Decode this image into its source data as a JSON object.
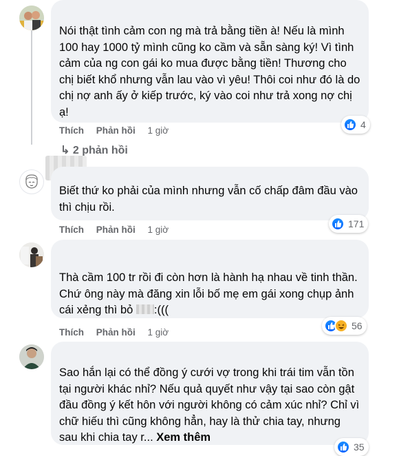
{
  "comments": [
    {
      "text": "Nói thật tình cảm con ng mà trả bằng tiền à! Nếu là mình 100 hay 1000 tỷ mình cũng ko cầm và sẵn sàng ký! Vì tình cảm của ng con gái ko mua được bằng tiền! Thương cho chị biết khổ nhưng vẫn lau vào vì yêu! Thôi coi như đó là do chị nợ anh ấy ở kiếp trước, ký vào coi như trả xong nợ chị ạ!",
      "like": "Thích",
      "reply": "Phản hồi",
      "time": "1 giờ",
      "reaction_count": "4",
      "replies": "2 phản hồi"
    },
    {
      "text": "Biết thứ ko phải của mình nhưng vẫn cố chấp đâm đầu vào thì chịu rồi.",
      "like": "Thích",
      "reply": "Phản hồi",
      "time": "1 giờ",
      "reaction_count": "171"
    },
    {
      "text_before": "Thà cầm 100 tr rồi đi còn hơn là hành hạ nhau về tinh thần. Chứ ông này mà đăng xin lỗi bố mẹ em gái xong chụp ảnh cái xẻng thì bỏ ",
      "text_after": ":(((",
      "like": "Thích",
      "reply": "Phản hồi",
      "time": "1 giờ",
      "reaction_count": "56"
    },
    {
      "text": "Sao hắn lại có thể đồng ý cưới vợ trong khi trái tim vẫn tồn tại người khác nhỉ? Nếu quả quyết như vậy tại sao còn gật đầu đồng ý kết hôn với người không có cảm xúc nhỉ? Chỉ vì chữ hiếu thì cũng không hẳn, hay là thử chia tay, nhưng sau khi chia tay r... ",
      "see_more": "Xem thêm",
      "reaction_count": "35"
    }
  ],
  "colors": {
    "bubble": "#f0f2f5",
    "meta": "#65676b",
    "like_blue": "#0866ff",
    "haha_yellow": "#f7b125"
  }
}
